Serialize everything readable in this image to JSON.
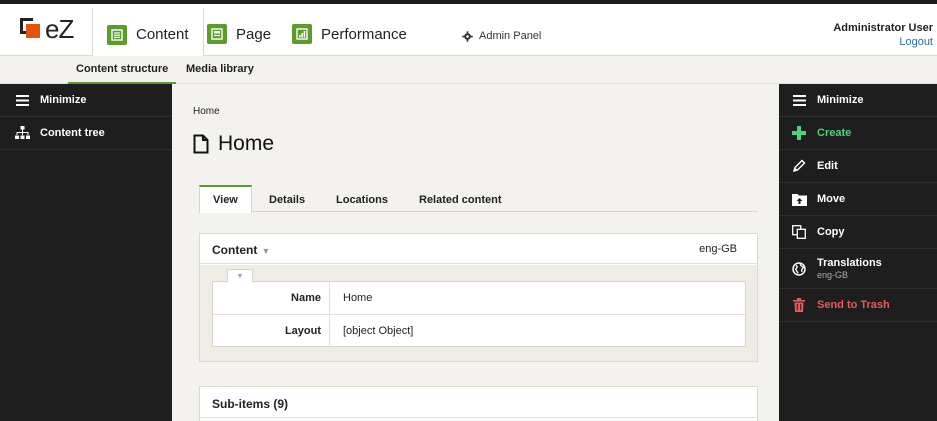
{
  "brand": {
    "name": "eZ"
  },
  "top_nav": {
    "items": [
      {
        "label": "Content",
        "icon": "content-icon",
        "active": true
      },
      {
        "label": "Page",
        "icon": "page-icon",
        "active": false
      },
      {
        "label": "Performance",
        "icon": "performance-icon",
        "active": false
      }
    ],
    "admin_panel": {
      "label": "Admin Panel",
      "icon": "gear-icon"
    },
    "user": {
      "name": "Administrator User",
      "logout": "Logout"
    }
  },
  "sub_nav": {
    "items": [
      {
        "label": "Content structure",
        "active": true
      },
      {
        "label": "Media library",
        "active": false
      }
    ]
  },
  "left_sidebar": {
    "items": [
      {
        "label": "Minimize",
        "icon": "hamburger-icon"
      },
      {
        "label": "Content tree",
        "icon": "tree-icon"
      }
    ]
  },
  "breadcrumb": "Home",
  "page": {
    "title": "Home",
    "icon": "document-icon"
  },
  "tabs": [
    {
      "label": "View",
      "active": true
    },
    {
      "label": "Details",
      "active": false
    },
    {
      "label": "Locations",
      "active": false
    },
    {
      "label": "Related content",
      "active": false
    }
  ],
  "content_panel": {
    "title": "Content",
    "caret": "▼",
    "language": "eng-GB",
    "fields_caret": "▼",
    "fields": [
      {
        "label": "Name",
        "value": "Home"
      },
      {
        "label": "Layout",
        "value": "[object Object]"
      }
    ]
  },
  "sub_items": {
    "title": "Sub-items (9)"
  },
  "right_sidebar": {
    "items": [
      {
        "label": "Minimize",
        "icon": "hamburger-icon"
      },
      {
        "label": "Create",
        "icon": "plus-icon",
        "color": "#4cd47a"
      },
      {
        "label": "Edit",
        "icon": "pencil-icon"
      },
      {
        "label": "Move",
        "icon": "move-folder-icon"
      },
      {
        "label": "Copy",
        "icon": "copy-icon"
      },
      {
        "label": "Translations",
        "sub": "eng-GB",
        "icon": "globe-icon"
      },
      {
        "label": "Send to Trash",
        "icon": "trash-icon",
        "color": "#e85a5a"
      }
    ]
  },
  "colors": {
    "accent": "#5e9b2d",
    "sidebar": "#1e1e1e",
    "background": "#f4f2ee",
    "brand_orange": "#e8500e"
  }
}
